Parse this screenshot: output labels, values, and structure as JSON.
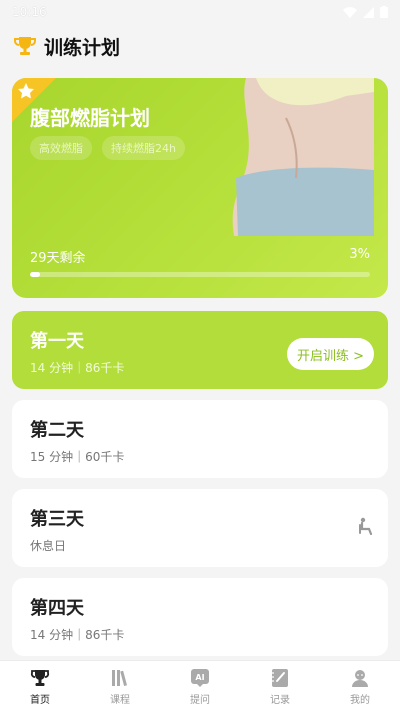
{
  "status": {
    "time": "10:16"
  },
  "header": {
    "title": "训练计划",
    "icon": "trophy-icon"
  },
  "hero": {
    "title": "腹部燃脂计划",
    "tags": [
      "高效燃脂",
      "持续燃脂24h"
    ],
    "days_left": "29天剩余",
    "percent_label": "3%",
    "progress": 0.03
  },
  "days": [
    {
      "title": "第一天",
      "meta": "14 分钟｜86千卡",
      "button": "开启训练 >"
    },
    {
      "title": "第二天",
      "meta": "15 分钟｜60千卡"
    },
    {
      "title": "第三天",
      "meta": "休息日",
      "icon": "rest-seat-icon"
    },
    {
      "title": "第四天",
      "meta": "14 分钟｜86千卡"
    }
  ],
  "tabs": [
    {
      "label": "首页",
      "icon": "trophy-icon"
    },
    {
      "label": "课程",
      "icon": "books-icon"
    },
    {
      "label": "提问",
      "icon": "ai-chat-icon"
    },
    {
      "label": "记录",
      "icon": "notebook-icon"
    },
    {
      "label": "我的",
      "icon": "profile-icon"
    }
  ],
  "colors": {
    "accent": "#b2dd3a",
    "hero": "#b6e03b"
  }
}
